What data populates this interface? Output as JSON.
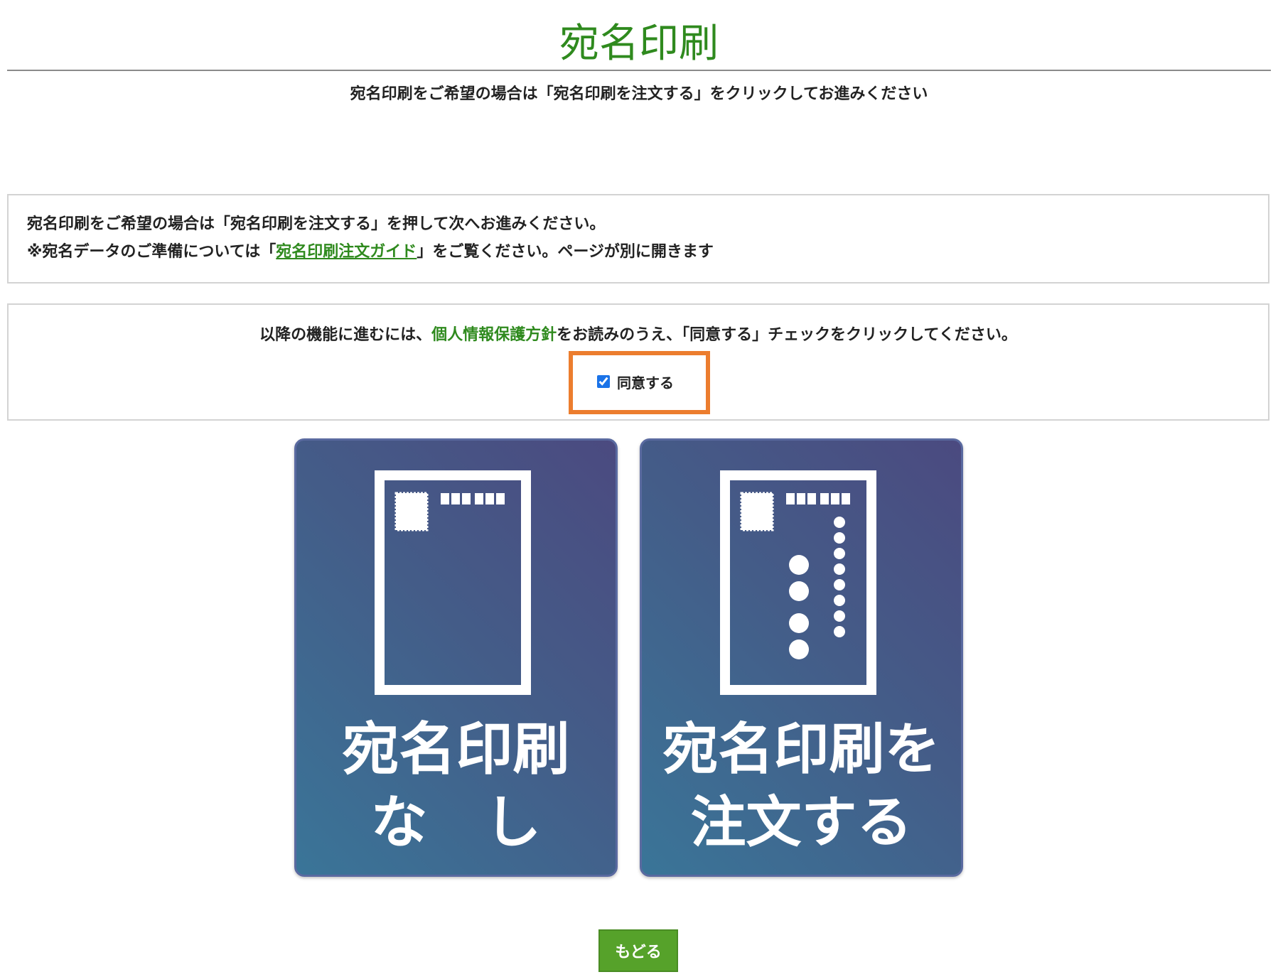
{
  "header": {
    "title": "宛名印刷",
    "subtitle": "宛名印刷をご希望の場合は「宛名印刷を注文する」をクリックしてお進みください"
  },
  "info_box": {
    "line1": "宛名印刷をご希望の場合は「宛名印刷を注文する」を押して次へお進みください。",
    "line2_prefix": "※宛名データのご準備については「",
    "guide_link": "宛名印刷注文ガイド",
    "line2_suffix": "」をご覧ください。ページが別に開きます"
  },
  "consent": {
    "text_prefix": "以降の機能に進むには、",
    "policy_link": "個人情報保護方針",
    "text_suffix": "をお読みのうえ、「同意する」チェックをクリックしてください。",
    "agree_label": "同意する",
    "agree_checked": true
  },
  "options": [
    {
      "line1": "宛名印刷",
      "line2": "な　し",
      "icon": "blank-postcard-icon"
    },
    {
      "line1": "宛名印刷を",
      "line2": "注文する",
      "icon": "addressed-postcard-icon"
    }
  ],
  "footer": {
    "back_label": "もどる"
  },
  "colors": {
    "title_green": "#2f8a1e",
    "highlight_orange": "#ec7d2e",
    "card_gradient_start": "#4b4a80",
    "card_gradient_end": "#3a7598",
    "back_button_green": "#56a22a"
  }
}
